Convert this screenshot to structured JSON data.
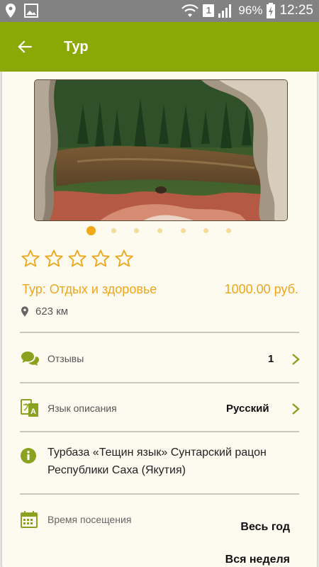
{
  "status_bar": {
    "battery": "96%",
    "sim": "1",
    "time": "12:25"
  },
  "app_bar": {
    "title": "Тур"
  },
  "gallery": {
    "dot_count": 7,
    "active_index": 0
  },
  "rating": {
    "value": 0,
    "max": 5
  },
  "tour": {
    "name": "Тур: Отдых и здоровье",
    "price": "1000.00 руб.",
    "distance": "623 км"
  },
  "reviews": {
    "label": "Отзывы",
    "count": "1"
  },
  "language": {
    "label": "Язык описания",
    "value": "Русский"
  },
  "info": {
    "text": "Турбаза «Тещин язык» Сунтарский рацон Республики Саха (Якутия)"
  },
  "visit": {
    "label": "Время посещения",
    "value1": "Весь год",
    "value2": "Вся неделя"
  },
  "colors": {
    "accent_green": "#8ba805",
    "accent_orange": "#eea61d",
    "icon_green": "#8aa21f"
  }
}
